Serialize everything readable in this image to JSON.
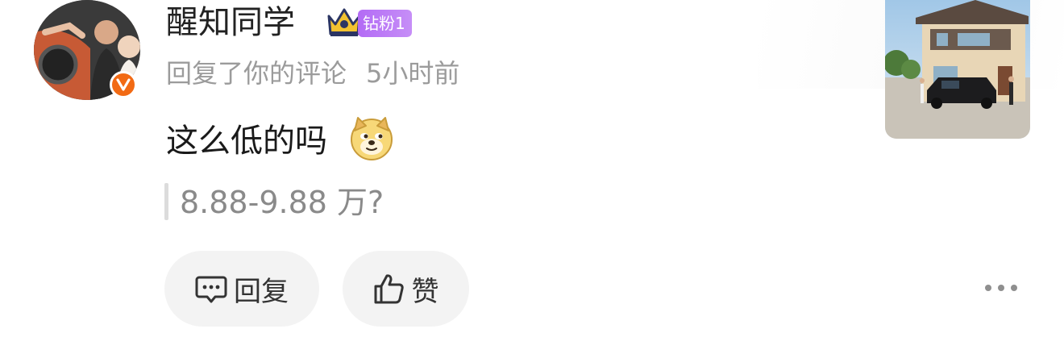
{
  "user": {
    "name": "醒知同学",
    "fan_badge": "钻粉1",
    "crown_level": "II"
  },
  "meta": {
    "action": "回复了你的评论",
    "time": "5小时前"
  },
  "comment": {
    "text": "这么低的吗",
    "emoji": "doge-emoji"
  },
  "quote": {
    "text": "8.88-9.88 万?"
  },
  "actions": {
    "reply_label": "回复",
    "like_label": "赞"
  },
  "colors": {
    "verified_badge": "#f26a14",
    "fan_badge": "#b36bf5",
    "pill_background": "#f3f3f3",
    "secondary_text": "#9b9b9b"
  }
}
